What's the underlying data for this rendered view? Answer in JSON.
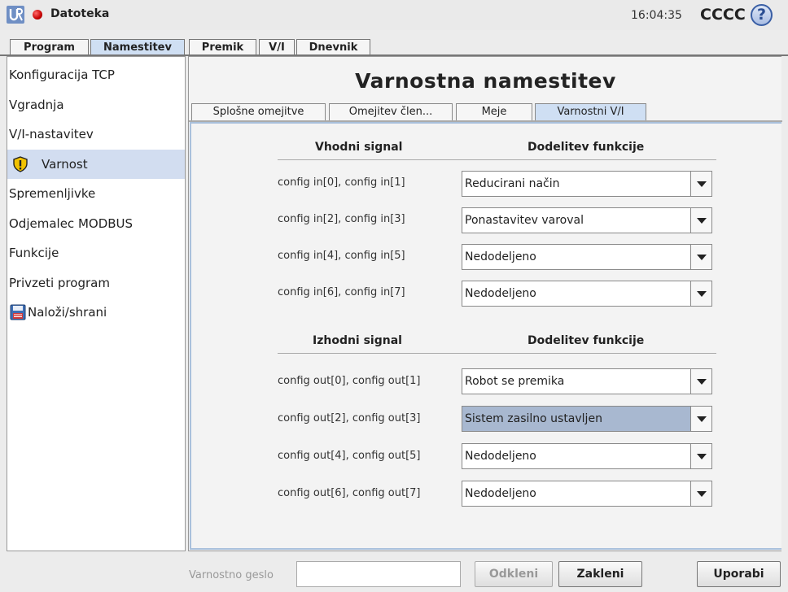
{
  "header": {
    "file_menu": "Datoteka",
    "time": "16:04:35",
    "robot_name": "CCCC",
    "help_symbol": "?"
  },
  "main_tabs": [
    {
      "label": "Program",
      "active": false
    },
    {
      "label": "Namestitev",
      "active": true
    },
    {
      "label": "Premik",
      "active": false
    },
    {
      "label": "V/I",
      "active": false
    },
    {
      "label": "Dnevnik",
      "active": false
    }
  ],
  "sidebar": {
    "items": [
      {
        "label": "Konfiguracija TCP",
        "icon": null,
        "selected": false
      },
      {
        "label": "Vgradnja",
        "icon": null,
        "selected": false
      },
      {
        "label": "V/I-nastavitev",
        "icon": null,
        "selected": false
      },
      {
        "label": "Varnost",
        "icon": "warning-shield-icon",
        "selected": true
      },
      {
        "label": "Spremenljivke",
        "icon": null,
        "selected": false
      },
      {
        "label": "Odjemalec MODBUS",
        "icon": null,
        "selected": false
      },
      {
        "label": "Funkcije",
        "icon": null,
        "selected": false
      },
      {
        "label": "Privzeti program",
        "icon": null,
        "selected": false
      },
      {
        "label": "Naloži/shrani",
        "icon": "floppy-disk-icon",
        "selected": false
      }
    ]
  },
  "page_title": "Varnostna namestitev",
  "sub_tabs": [
    {
      "label": "Splošne omejitve",
      "active": false
    },
    {
      "label": "Omejitev člen...",
      "active": false
    },
    {
      "label": "Meje",
      "active": false
    },
    {
      "label": "Varnostni V/I",
      "active": true
    }
  ],
  "inputs_section": {
    "signal_header": "Vhodni signal",
    "function_header": "Dodelitev funkcije",
    "rows": [
      {
        "signal": "config in[0], config in[1]",
        "function": "Reducirani način"
      },
      {
        "signal": "config in[2], config in[3]",
        "function": "Ponastavitev varoval"
      },
      {
        "signal": "config in[4], config in[5]",
        "function": "Nedodeljeno"
      },
      {
        "signal": "config in[6], config in[7]",
        "function": "Nedodeljeno"
      }
    ]
  },
  "outputs_section": {
    "signal_header": "Izhodni signal",
    "function_header": "Dodelitev funkcije",
    "rows": [
      {
        "signal": "config out[0], config out[1]",
        "function": "Robot se premika",
        "highlighted": false
      },
      {
        "signal": "config out[2], config out[3]",
        "function": "Sistem zasilno ustavljen",
        "highlighted": true
      },
      {
        "signal": "config out[4], config out[5]",
        "function": "Nedodeljeno",
        "highlighted": false
      },
      {
        "signal": "config out[6], config out[7]",
        "function": "Nedodeljeno",
        "highlighted": false
      }
    ]
  },
  "footer": {
    "password_label": "Varnostno geslo",
    "password_value": "",
    "unlock_label": "Odkleni",
    "lock_label": "Zakleni",
    "apply_label": "Uporabi"
  },
  "colors": {
    "selected_tab": "#cfdff3",
    "selected_sidebar": "#d2ddf0",
    "highlight_select": "#a8b8d0",
    "status_led": "#c60000"
  }
}
